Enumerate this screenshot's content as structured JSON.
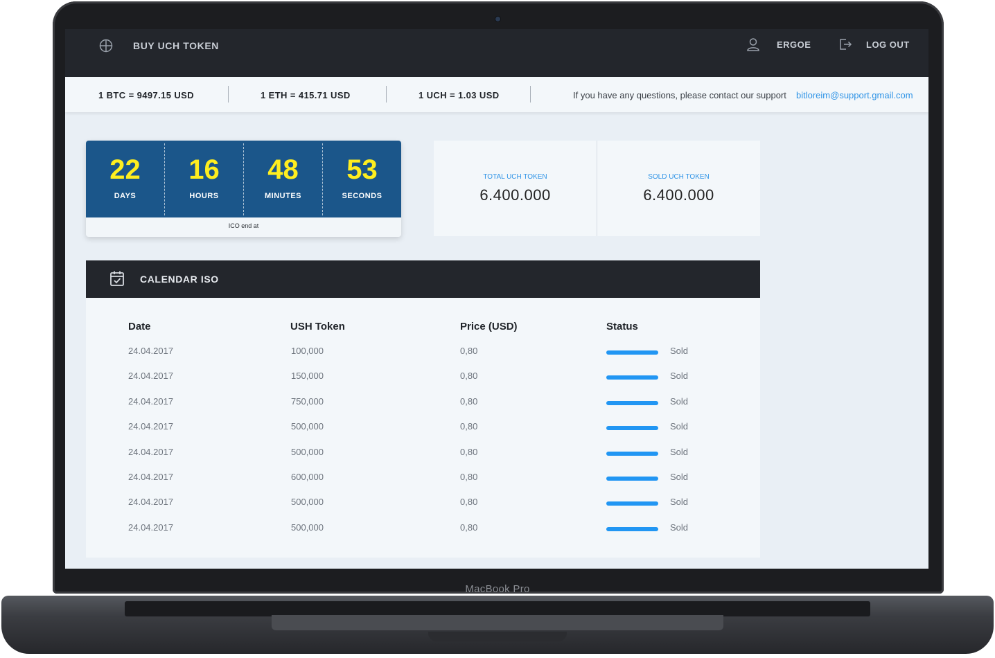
{
  "device": {
    "label": "MacBook Pro"
  },
  "topbar": {
    "brand_icon": "crosshair-circle-icon",
    "brand": "BUY UCH TOKEN",
    "user_icon": "user-icon",
    "user": "ERGOE",
    "logout_icon": "logout-icon",
    "logout": "LOG OUT"
  },
  "rates": {
    "items": [
      "1 BTC = 9497.15 USD",
      "1 ETH = 415.71 USD",
      "1 UCH = 1.03 USD"
    ],
    "support_text": "If you have any questions, please contact our support",
    "support_email": "bitloreim@support.gmail.com"
  },
  "countdown": {
    "units": [
      {
        "value": "22",
        "label": "DAYS"
      },
      {
        "value": "16",
        "label": "HOURS"
      },
      {
        "value": "48",
        "label": "MINUTES"
      },
      {
        "value": "53",
        "label": "SECONDS"
      }
    ],
    "footer": "ICO end at"
  },
  "stats": [
    {
      "label": "TOTAL UCH TOKEN",
      "value": "6.400.000"
    },
    {
      "label": "SOLD UCH TOKEN",
      "value": "6.400.000"
    }
  ],
  "calendar": {
    "icon": "calendar-check-icon",
    "title": "CALENDAR ISO",
    "columns": [
      "Date",
      "USH Token",
      "Price (USD)",
      "Status"
    ],
    "rows": [
      {
        "date": "24.04.2017",
        "token": "100,000",
        "price": "0,80",
        "progress": 1.0,
        "status": "Sold"
      },
      {
        "date": "24.04.2017",
        "token": "150,000",
        "price": "0,80",
        "progress": 1.0,
        "status": "Sold"
      },
      {
        "date": "24.04.2017",
        "token": "750,000",
        "price": "0,80",
        "progress": 1.0,
        "status": "Sold"
      },
      {
        "date": "24.04.2017",
        "token": "500,000",
        "price": "0,80",
        "progress": 1.0,
        "status": "Sold"
      },
      {
        "date": "24.04.2017",
        "token": "500,000",
        "price": "0,80",
        "progress": 1.0,
        "status": "Sold"
      },
      {
        "date": "24.04.2017",
        "token": "600,000",
        "price": "0,80",
        "progress": 1.0,
        "status": "Sold"
      },
      {
        "date": "24.04.2017",
        "token": "500,000",
        "price": "0,80",
        "progress": 1.0,
        "status": "Sold"
      },
      {
        "date": "24.04.2017",
        "token": "500,000",
        "price": "0,80",
        "progress": 1.0,
        "status": "Sold"
      }
    ]
  },
  "colors": {
    "accent": "#2e93e6",
    "countdown_bg": "#1b568a",
    "countdown_digits": "#ffee1f",
    "status_bar": "#2196f3",
    "dark_bar": "#23262c"
  }
}
